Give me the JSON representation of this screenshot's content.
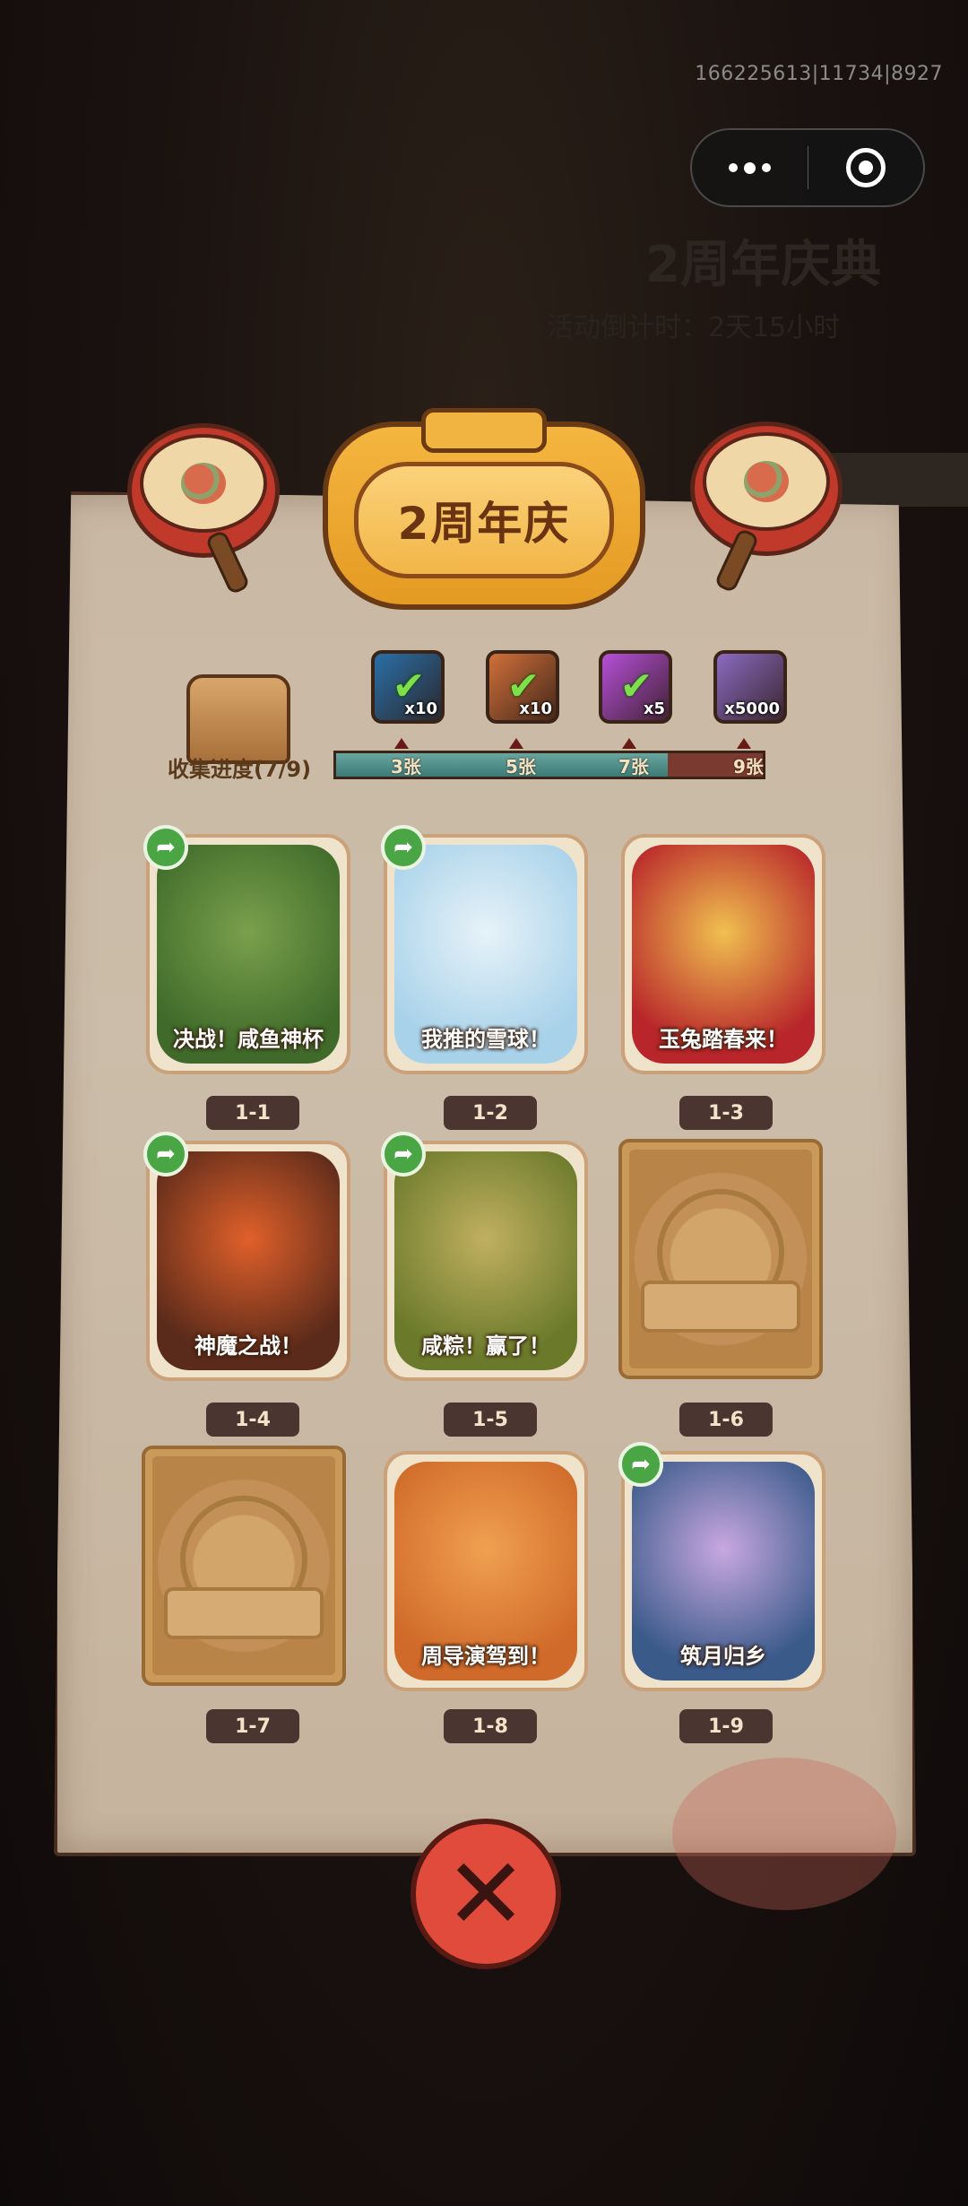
{
  "debug_id": "166225613|11734|8927",
  "background": {
    "title": "2周年庆典",
    "subtitle": "活动倒计时：2天15小时"
  },
  "capsule": {
    "more_icon": "more-dots-icon",
    "close_icon": "target-icon"
  },
  "title": "2周年庆",
  "progress": {
    "label": "收集进度(7/9)",
    "collected": 7,
    "total": 9
  },
  "rewards": [
    {
      "icon": "chest-item",
      "qty": "x10",
      "claimed": true,
      "color": "#2a6fa8"
    },
    {
      "icon": "key-item",
      "qty": "x10",
      "claimed": true,
      "color": "#d0703a"
    },
    {
      "icon": "orb-item",
      "qty": "x5",
      "claimed": true,
      "color": "#b64fd8"
    },
    {
      "icon": "crystal-item",
      "qty": "x5000",
      "claimed": false,
      "color": "#8a6ac0"
    }
  ],
  "milestones": [
    "3张",
    "5张",
    "7张",
    "9张"
  ],
  "cards": [
    {
      "id": "1-1",
      "title": "决战！咸鱼神杯",
      "unlocked": true,
      "shared": true,
      "colors": [
        "#3f6a2a",
        "#7aa04c"
      ]
    },
    {
      "id": "1-2",
      "title": "我推的雪球！",
      "unlocked": true,
      "shared": true,
      "colors": [
        "#a8d2ea",
        "#e7f2f8"
      ]
    },
    {
      "id": "1-3",
      "title": "玉兔踏春来！",
      "unlocked": true,
      "shared": false,
      "colors": [
        "#b8252a",
        "#f0c050"
      ]
    },
    {
      "id": "1-4",
      "title": "神魔之战！",
      "unlocked": true,
      "shared": true,
      "colors": [
        "#5a2a1a",
        "#e0602a"
      ]
    },
    {
      "id": "1-5",
      "title": "咸粽！赢了！",
      "unlocked": true,
      "shared": true,
      "colors": [
        "#6a7a2a",
        "#c0b060"
      ]
    },
    {
      "id": "1-6",
      "title": "",
      "unlocked": false,
      "shared": false,
      "colors": [
        "#c29058",
        "#d2a66a"
      ]
    },
    {
      "id": "1-7",
      "title": "",
      "unlocked": false,
      "shared": false,
      "colors": [
        "#c29058",
        "#d2a66a"
      ]
    },
    {
      "id": "1-8",
      "title": "周导演驾到！",
      "unlocked": true,
      "shared": false,
      "colors": [
        "#d06a2a",
        "#f0a050"
      ]
    },
    {
      "id": "1-9",
      "title": "筑月归乡",
      "unlocked": true,
      "shared": true,
      "colors": [
        "#3a5a8a",
        "#c8a8e0"
      ]
    }
  ],
  "close_icon": "close-icon"
}
